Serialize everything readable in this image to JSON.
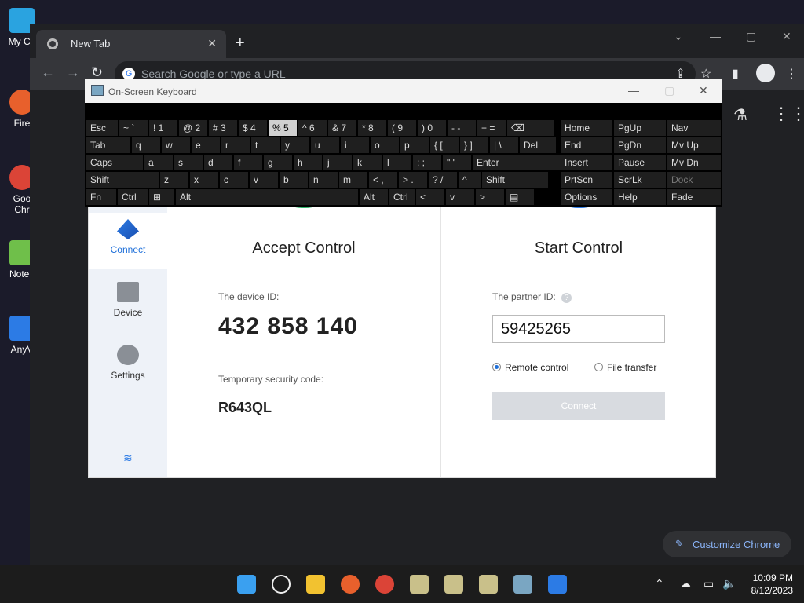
{
  "desktop": {
    "icons": [
      "My Co",
      "Fire",
      "Goo Chr",
      "Notep",
      "AnyV"
    ]
  },
  "browser": {
    "tab_title": "New Tab",
    "omnibox_placeholder": "Search Google or type a URL",
    "customize_label": "Customize Chrome"
  },
  "osk": {
    "title": "On-Screen Keyboard",
    "keys": [
      [
        "Esc",
        "~ `",
        "! 1",
        "@ 2",
        "# 3",
        "$ 4",
        "% 5",
        "^ 6",
        "& 7",
        "* 8",
        "( 9",
        ") 0",
        "- -",
        "+ =",
        "⌫"
      ],
      [
        "Tab",
        "q",
        "w",
        "e",
        "r",
        "t",
        "y",
        "u",
        "i",
        "o",
        "p",
        "{ [",
        "} ]",
        "| \\",
        "Del"
      ],
      [
        "Caps",
        "a",
        "s",
        "d",
        "f",
        "g",
        "h",
        "j",
        "k",
        "l",
        ": ;",
        "\" '",
        "Enter"
      ],
      [
        "Shift",
        "z",
        "x",
        "c",
        "v",
        "b",
        "n",
        "m",
        "< ,",
        "> .",
        "? /",
        "^",
        "Shift"
      ],
      [
        "Fn",
        "Ctrl",
        "⊞",
        "Alt",
        "Alt",
        "Ctrl",
        "<",
        "v",
        ">",
        "▤"
      ]
    ],
    "right_keys": [
      [
        "Home",
        "PgUp",
        "Nav"
      ],
      [
        "End",
        "PgDn",
        "Mv Up"
      ],
      [
        "Insert",
        "Pause",
        "Mv Dn"
      ],
      [
        "PrtScn",
        "ScrLk",
        "Dock"
      ],
      [
        "Options",
        "Help",
        "Fade"
      ]
    ]
  },
  "anydesk": {
    "sidebar": {
      "connect": "Connect",
      "device": "Device",
      "settings": "Settings"
    },
    "accept": {
      "title": "Accept Control",
      "device_id_label": "The device ID:",
      "device_id": "432 858 140",
      "security_label": "Temporary security code:",
      "security_code": "R643QL"
    },
    "start": {
      "title": "Start Control",
      "partner_label": "The partner ID:",
      "partner_value": "59425265",
      "radio_remote": "Remote control",
      "radio_file": "File transfer",
      "connect_button": "Connect"
    }
  },
  "taskbar": {
    "time": "10:09 PM",
    "date": "8/12/2023"
  }
}
